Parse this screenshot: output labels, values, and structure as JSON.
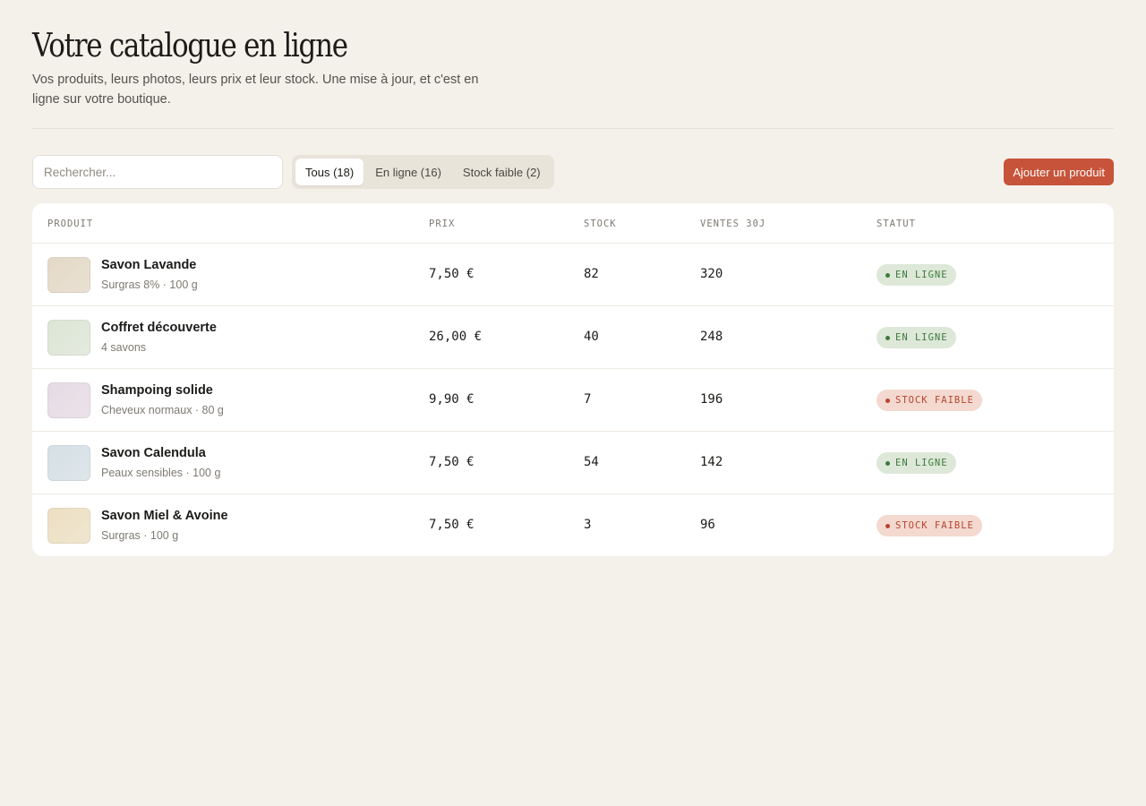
{
  "header": {
    "title": "Votre catalogue en ligne",
    "subtitle": "Vos produits, leurs photos, leurs prix et leur stock. Une mise à jour, et c'est en ligne sur votre boutique."
  },
  "toolbar": {
    "search_placeholder": "Rechercher...",
    "filters": [
      {
        "label": "Tous (18)",
        "active": true
      },
      {
        "label": "En ligne (16)",
        "active": false
      },
      {
        "label": "Stock faible (2)",
        "active": false
      }
    ],
    "add_label": "Ajouter un produit"
  },
  "table": {
    "headers": {
      "product": "PRODUIT",
      "price": "PRIX",
      "stock": "STOCK",
      "sales": "VENTES 30J",
      "status": "STATUT"
    },
    "rows": [
      {
        "name": "Savon Lavande",
        "desc": "Surgras 8% · 100 g",
        "price": "7,50 €",
        "stock": "82",
        "sales": "320",
        "status": "EN LIGNE",
        "status_kind": "ok",
        "thumb_color": "#e4d9c8"
      },
      {
        "name": "Coffret découverte",
        "desc": "4 savons",
        "price": "26,00 €",
        "stock": "40",
        "sales": "248",
        "status": "EN LIGNE",
        "status_kind": "ok",
        "thumb_color": "#dde5d6"
      },
      {
        "name": "Shampoing solide",
        "desc": "Cheveux normaux · 80 g",
        "price": "9,90 €",
        "stock": "7",
        "sales": "196",
        "status": "STOCK FAIBLE",
        "status_kind": "low",
        "thumb_color": "#e6dbe4"
      },
      {
        "name": "Savon Calendula",
        "desc": "Peaux sensibles · 100 g",
        "price": "7,50 €",
        "stock": "54",
        "sales": "142",
        "status": "EN LIGNE",
        "status_kind": "ok",
        "thumb_color": "#d6e0e5"
      },
      {
        "name": "Savon Miel & Avoine",
        "desc": "Surgras · 100 g",
        "price": "7,50 €",
        "stock": "3",
        "sales": "96",
        "status": "STOCK FAIBLE",
        "status_kind": "low",
        "thumb_color": "#ecdfc3"
      }
    ]
  },
  "colors": {
    "background": "#f4f1eb",
    "accent": "#c6533a",
    "status_ok": "#3e7a3e",
    "status_low": "#b8452e"
  }
}
